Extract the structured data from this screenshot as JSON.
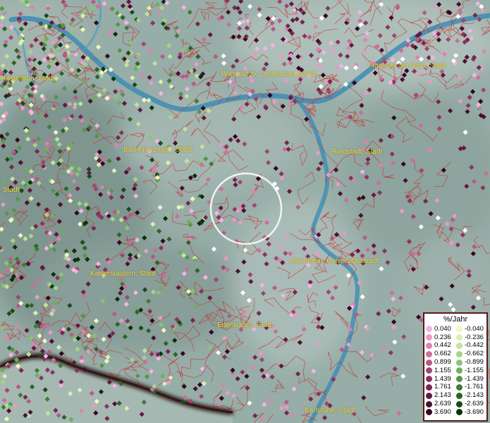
{
  "map": {
    "colors": {
      "water": "#3e8cb4",
      "coast": "#1b0808",
      "boundary": "#c82a2a"
    },
    "cities": [
      {
        "name": "Kastellaun, Stadt"
      },
      {
        "name": "Wiesbaden, Landeshauptstadt"
      },
      {
        "name": "Frankfurt am Main, Stadt"
      },
      {
        "name": "Bad Kreuznach, Stadt"
      },
      {
        "name": "Riedstadt, Stadt"
      },
      {
        "name": "Stadt"
      },
      {
        "name": "Kaiserslautern, Stadt"
      },
      {
        "name": "Mannheim, Universitätsstadt"
      },
      {
        "name": "Edenkoben, Stadt"
      },
      {
        "name": "Karlsruhe, Stadt"
      }
    ]
  },
  "legend": {
    "title": "%/Jahr",
    "positive": [
      {
        "value": "0.040",
        "color": "#f5b3e4"
      },
      {
        "value": "0.236",
        "color": "#e89ac9"
      },
      {
        "value": "0.442",
        "color": "#db84b1"
      },
      {
        "value": "0.662",
        "color": "#cc6e9b"
      },
      {
        "value": "0.899",
        "color": "#b85a84"
      },
      {
        "value": "1.155",
        "color": "#a14570"
      },
      {
        "value": "1.439",
        "color": "#8c3360"
      },
      {
        "value": "1.761",
        "color": "#782550"
      },
      {
        "value": "2.143",
        "color": "#631840"
      },
      {
        "value": "2.639",
        "color": "#4d0e30"
      },
      {
        "value": "3.690",
        "color": "#330620"
      }
    ],
    "negative": [
      {
        "value": "-0.040",
        "color": "#f1f7c0"
      },
      {
        "value": "-0.236",
        "color": "#dcefae"
      },
      {
        "value": "-0.442",
        "color": "#c2e399"
      },
      {
        "value": "-0.662",
        "color": "#a6d486"
      },
      {
        "value": "-0.899",
        "color": "#8cc374"
      },
      {
        "value": "-1.155",
        "color": "#70ad5c"
      },
      {
        "value": "-1.439",
        "color": "#55954a"
      },
      {
        "value": "-1.761",
        "color": "#3e7c37"
      },
      {
        "value": "-2.143",
        "color": "#2b6427"
      },
      {
        "value": "-2.639",
        "color": "#1a4a19"
      },
      {
        "value": "-3.690",
        "color": "#0a300c"
      }
    ]
  }
}
